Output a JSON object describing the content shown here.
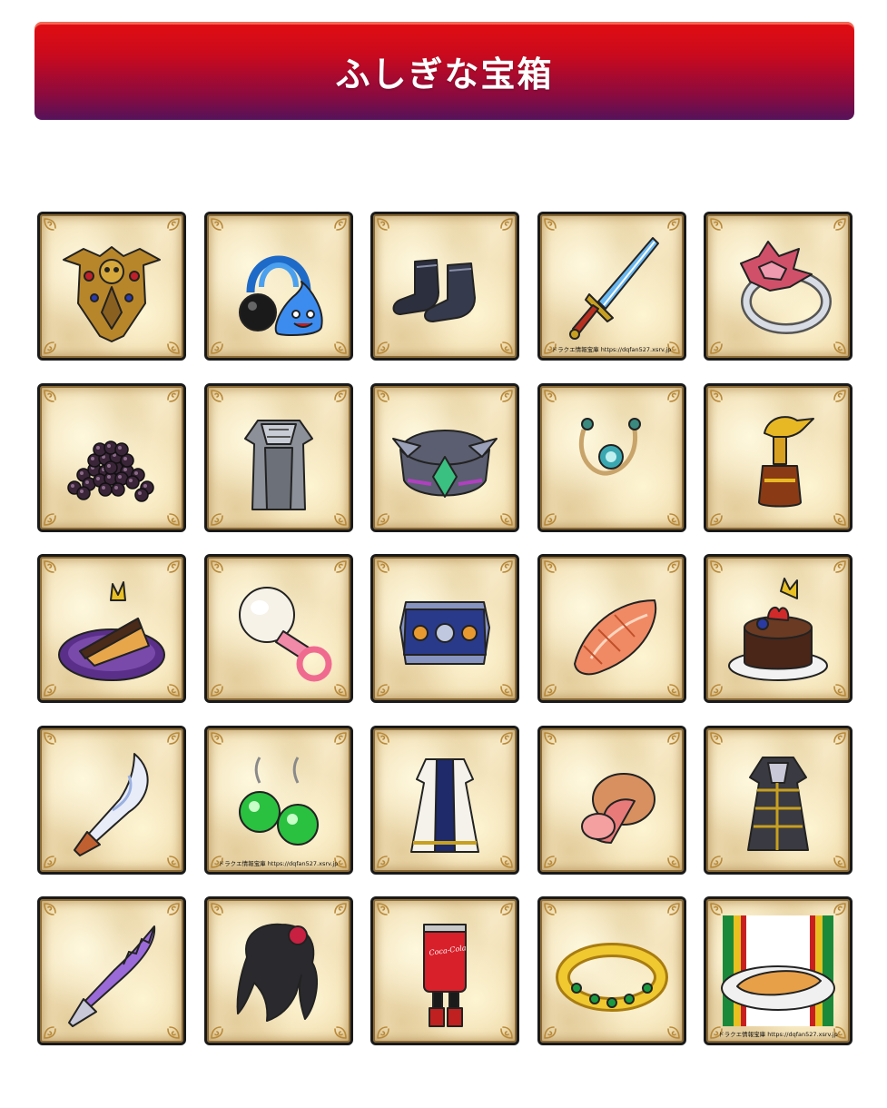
{
  "header": {
    "title": "ふしぎな宝箱"
  },
  "items": [
    {
      "icon": "golden-skull-shield-icon"
    },
    {
      "icon": "slime-earmuffs-icon"
    },
    {
      "icon": "ninja-tabi-boots-icon"
    },
    {
      "icon": "blue-blade-sword-icon",
      "watermark": "ドラクエ情報宝庫 https://dqfan527.xsrv.jp"
    },
    {
      "icon": "thorn-silver-ring-icon"
    },
    {
      "icon": "black-bean-pile-icon"
    },
    {
      "icon": "silver-robe-armor-icon"
    },
    {
      "icon": "winged-silver-bracelet-icon"
    },
    {
      "icon": "pearl-bead-necklace-icon"
    },
    {
      "icon": "golden-bird-perfume-bottle-icon"
    },
    {
      "icon": "chocolate-cake-slice-icon"
    },
    {
      "icon": "pearl-pacifier-icon"
    },
    {
      "icon": "blue-gem-armband-icon"
    },
    {
      "icon": "grilled-salmon-fillet-icon"
    },
    {
      "icon": "chocolate-strawberry-cake-icon"
    },
    {
      "icon": "white-fin-sword-icon"
    },
    {
      "icon": "green-orb-earrings-icon",
      "watermark": "ドラクエ情報宝庫 https://dqfan527.xsrv.jp"
    },
    {
      "icon": "white-priest-robe-icon"
    },
    {
      "icon": "ham-roast-icon"
    },
    {
      "icon": "dark-gold-coat-icon"
    },
    {
      "icon": "purple-serrated-sword-icon"
    },
    {
      "icon": "black-wavy-hair-rose-icon"
    },
    {
      "icon": "cola-can-costume-icon"
    },
    {
      "icon": "gold-emerald-ring-icon"
    },
    {
      "icon": "gyoza-plate-icon",
      "watermark": "ドラクエ情報宝庫 https://dqfan527.xsrv.jp"
    }
  ],
  "colors": {
    "banner_top": "#e30d10",
    "banner_bottom": "#55125a",
    "tile_border": "#1a1a1a",
    "parchment": "#f3e2b8"
  },
  "can_text": "Coca-Cola"
}
